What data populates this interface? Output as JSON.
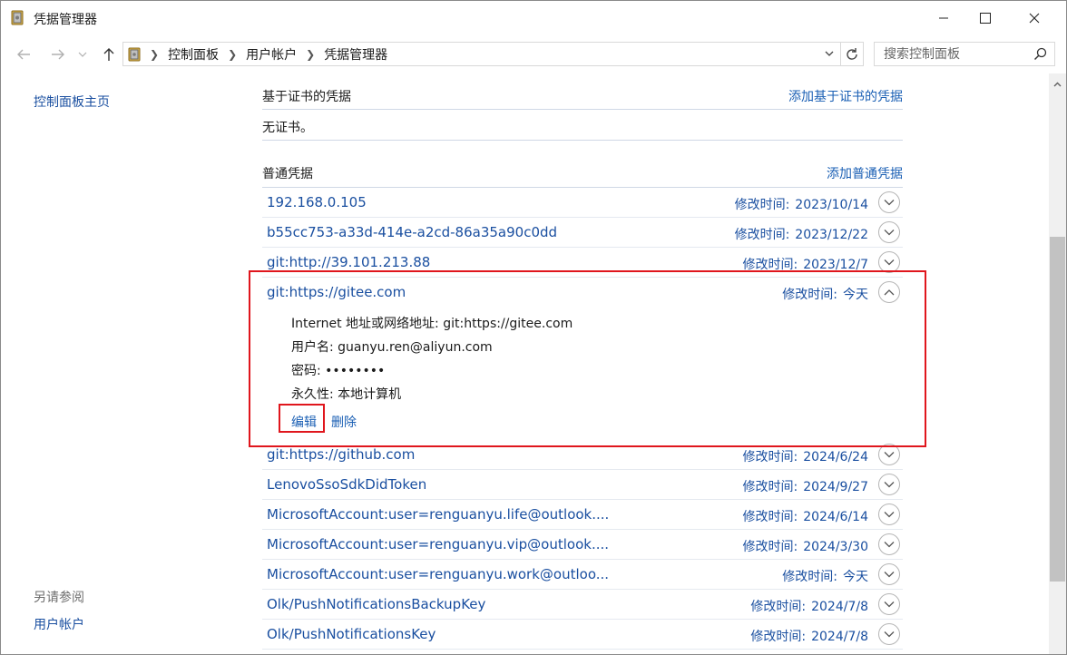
{
  "window": {
    "title": "凭据管理器"
  },
  "address": {
    "breadcrumbs": [
      "控制面板",
      "用户帐户",
      "凭据管理器"
    ]
  },
  "search": {
    "placeholder": "搜索控制面板"
  },
  "sidebar": {
    "home_link": "控制面板主页",
    "see_also_heading": "另请参阅",
    "see_also_links": [
      "用户帐户"
    ]
  },
  "cert_section": {
    "heading": "基于证书的凭据",
    "add_link": "添加基于证书的凭据",
    "empty_text": "无证书。"
  },
  "generic_section": {
    "heading": "普通凭据",
    "add_link": "添加普通凭据",
    "mod_prefix": "修改时间:",
    "items": [
      {
        "name": "192.168.0.105",
        "modified": "2023/10/14"
      },
      {
        "name": "b55cc753-a33d-414e-a2cd-86a35a90c0dd",
        "modified": "2023/12/22"
      },
      {
        "name": "git:http://39.101.213.88",
        "modified": "2023/12/7"
      },
      {
        "name": "git:https://gitee.com",
        "modified": "今天",
        "expanded": true
      },
      {
        "name": "git:https://github.com",
        "modified": "2024/6/24"
      },
      {
        "name": "LenovoSsoSdkDidToken",
        "modified": "2024/9/27"
      },
      {
        "name": "MicrosoftAccount:user=renguanyu.life@outlook....",
        "modified": "2024/6/14"
      },
      {
        "name": "MicrosoftAccount:user=renguanyu.vip@outlook....",
        "modified": "2024/3/30"
      },
      {
        "name": "MicrosoftAccount:user=renguanyu.work@outloo...",
        "modified": "今天"
      },
      {
        "name": "Olk/PushNotificationsBackupKey",
        "modified": "2024/7/8"
      },
      {
        "name": "Olk/PushNotificationsKey",
        "modified": "2024/7/8"
      }
    ]
  },
  "expanded_detail": {
    "address_label": "Internet 地址或网络地址:",
    "address_value": "git:https://gitee.com",
    "username_label": "用户名:",
    "username_value": "guanyu.ren@aliyun.com",
    "password_label": "密码:",
    "password_value": "••••••••",
    "persistence_label": "永久性:",
    "persistence_value": "本地计算机",
    "edit_label": "编辑",
    "delete_label": "删除"
  },
  "colors": {
    "link": "#1a4fa0",
    "highlight_box": "#e0161d"
  }
}
